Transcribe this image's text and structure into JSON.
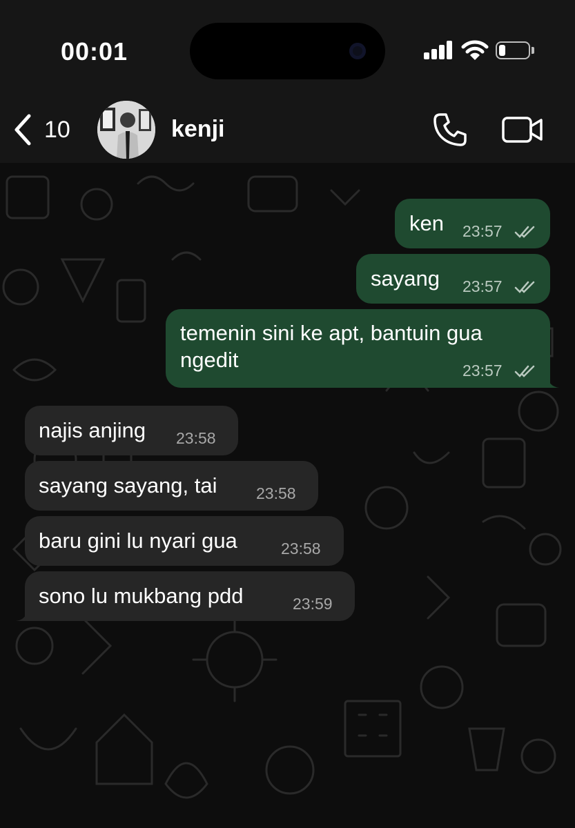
{
  "status_bar": {
    "time": "00:01"
  },
  "header": {
    "back_count": "10",
    "contact_name": "kenji"
  },
  "messages": [
    {
      "direction": "out",
      "text": "ken",
      "time": "23:57",
      "status": "read"
    },
    {
      "direction": "out",
      "text": "sayang",
      "time": "23:57",
      "status": "read"
    },
    {
      "direction": "out",
      "text_line1": "temenin sini ke apt, bantuin gua",
      "text_line2": "ngedit",
      "time": "23:57",
      "status": "read"
    },
    {
      "direction": "in",
      "text": "najis anjing",
      "time": "23:58"
    },
    {
      "direction": "in",
      "text": "sayang sayang, tai",
      "time": "23:58"
    },
    {
      "direction": "in",
      "text": "baru gini lu nyari gua",
      "time": "23:58"
    },
    {
      "direction": "in",
      "text": "sono lu mukbang pdd",
      "time": "23:59"
    }
  ],
  "colors": {
    "outgoing_bubble": "#1f4a30",
    "incoming_bubble": "#262626",
    "background": "#0d0d0d"
  },
  "icons": [
    "back-chevron-icon",
    "phone-icon",
    "video-camera-icon",
    "double-check-icon",
    "wifi-icon",
    "signal-icon",
    "battery-icon"
  ]
}
